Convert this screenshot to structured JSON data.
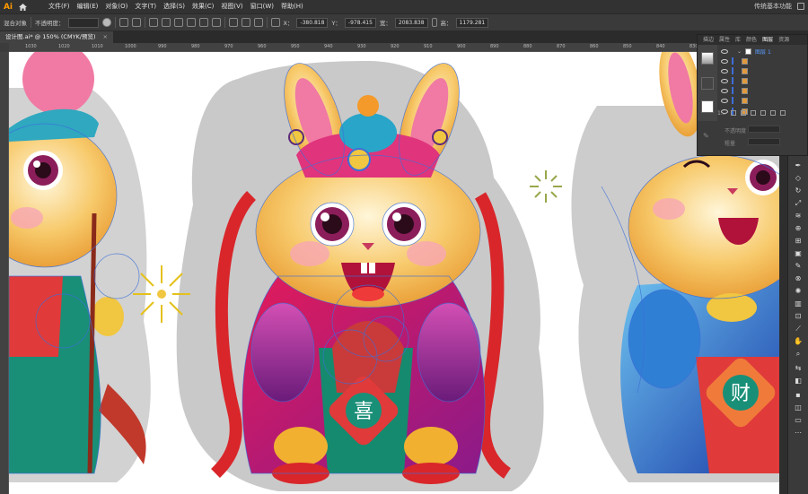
{
  "app": {
    "logo": "Ai",
    "workspace": "传统基本功能"
  },
  "menu": [
    "文件(F)",
    "编辑(E)",
    "对象(O)",
    "文字(T)",
    "选择(S)",
    "效果(C)",
    "视图(V)",
    "窗口(W)",
    "帮助(H)"
  ],
  "control": {
    "selection": "混合对象",
    "opacity_label": "不透明度：",
    "x_label": "X：",
    "x_value": "-380.818",
    "y_label": "Y：",
    "y_value": "-978.415",
    "w_label": "宽：",
    "w_value": "2083.838",
    "h_label": "高：",
    "h_value": "1179.281"
  },
  "document": {
    "tab": "设计图.ai* @ 150% (CMYK/预览)",
    "close": "×"
  },
  "ruler_ticks": [
    "1030",
    "1020",
    "1010",
    "1000",
    "990",
    "980",
    "970",
    "960",
    "950",
    "940",
    "930",
    "920",
    "910",
    "900",
    "890",
    "880",
    "870",
    "860",
    "850",
    "840",
    "830"
  ],
  "panel": {
    "tabs": [
      "描边",
      "属性",
      "库",
      "颜色",
      "图层",
      "资源"
    ],
    "layer_name": "图层 1",
    "footer_count": "1...",
    "lower": {
      "opacity": "不透明度",
      "stroke": "粗量"
    }
  },
  "artwork": {
    "char_left": "喜",
    "char_right": "财"
  },
  "colors": {
    "accent": "#ff9a00",
    "path_blue": "#3d6fd8"
  }
}
